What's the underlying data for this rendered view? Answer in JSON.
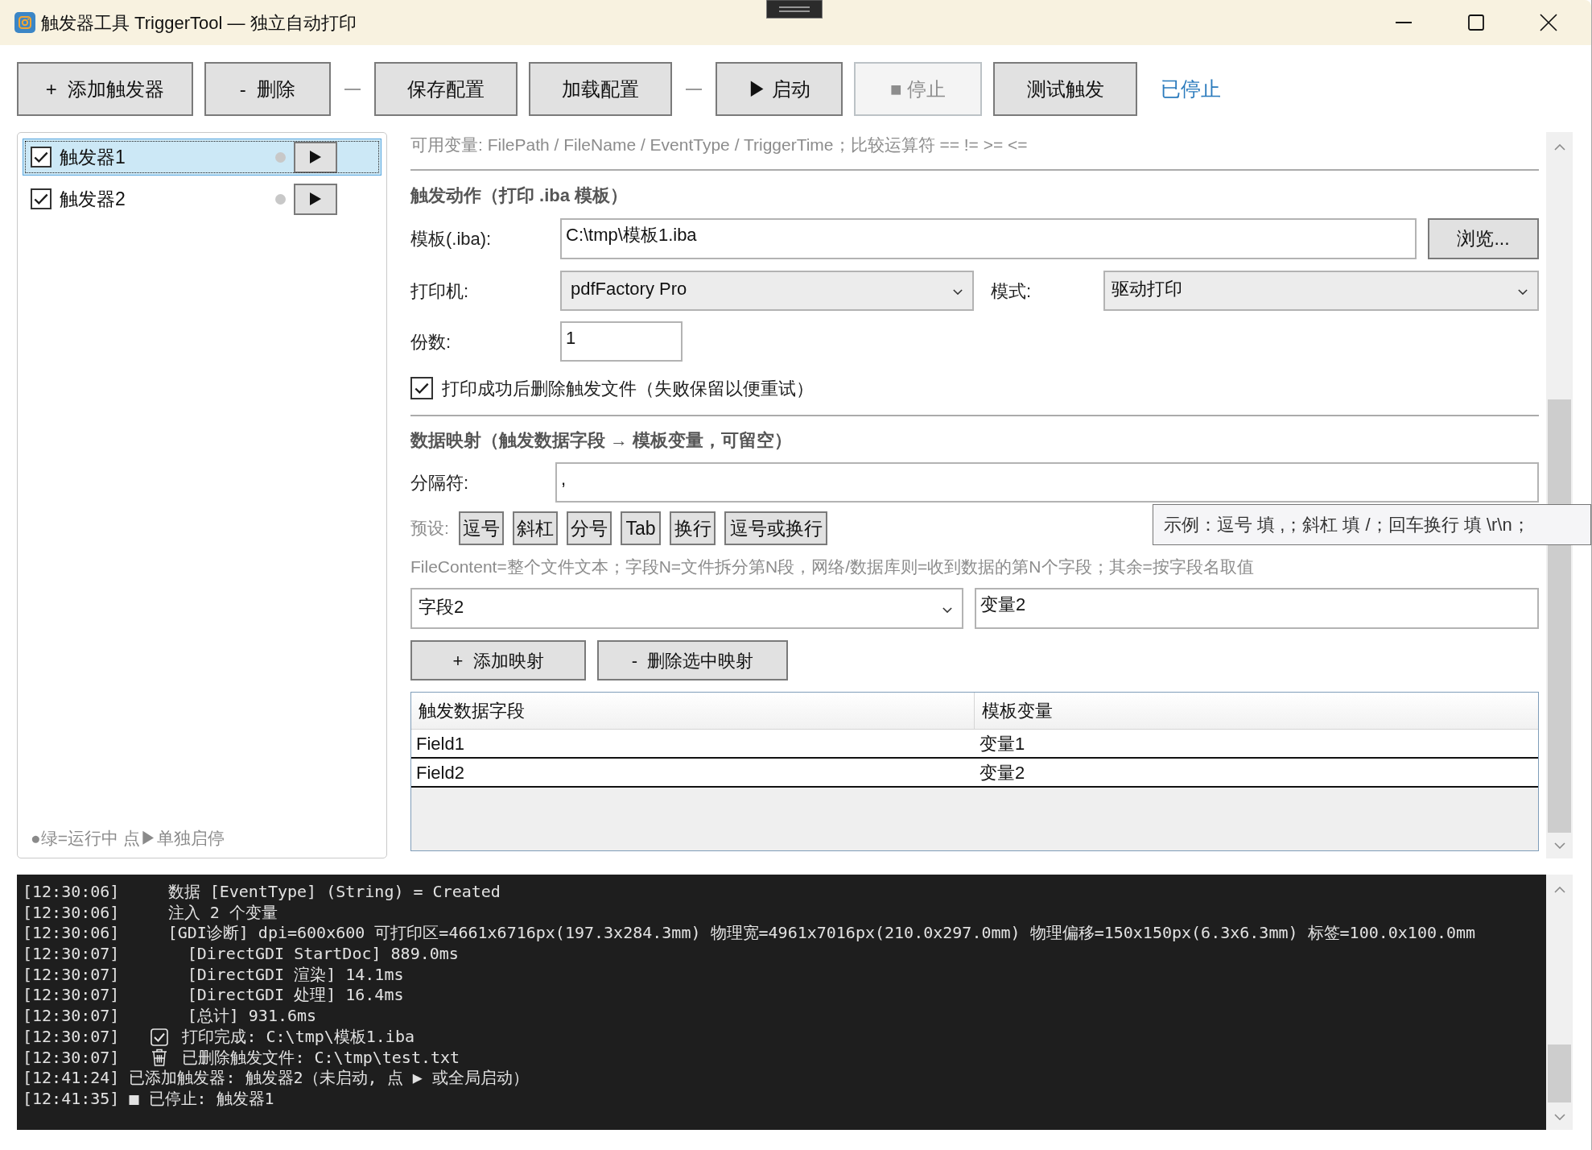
{
  "window": {
    "title": "触发器工具 TriggerTool — 独立自动打印"
  },
  "toolbar": {
    "items": [
      {
        "kind": "button",
        "label": "+  添加触发器",
        "disabled": false
      },
      {
        "kind": "button",
        "label": "-  删除",
        "disabled": false
      },
      {
        "kind": "separator"
      },
      {
        "kind": "button",
        "label": "保存配置",
        "disabled": false
      },
      {
        "kind": "button",
        "label": "加载配置",
        "disabled": false
      },
      {
        "kind": "separator"
      },
      {
        "kind": "button",
        "label": "▶ 启动",
        "disabled": false
      },
      {
        "kind": "button",
        "label": "■ 停止",
        "disabled": true
      },
      {
        "kind": "button",
        "label": "测试触发",
        "disabled": false
      }
    ],
    "status": "已停止"
  },
  "triggers": [
    {
      "name": "触发器1",
      "checked": true,
      "selected": true,
      "running": false
    },
    {
      "name": "触发器2",
      "checked": true,
      "selected": false,
      "running": false
    }
  ],
  "trigger_list_hint": "●绿=运行中 点▶单独启停",
  "variables_hint": "可用变量: FilePath / FileName / EventType / TriggerTime；比较运算符 == != >= <=",
  "print_action": {
    "heading": "触发动作（打印 .iba 模板）",
    "template": {
      "label": "模板(.iba):",
      "value": "C:\\tmp\\模板1.iba"
    },
    "browse_button": "浏览...",
    "printer": {
      "label": "打印机:",
      "value": "pdfFactory Pro"
    },
    "mode": {
      "label": "模式:",
      "value": "驱动打印"
    },
    "copies": {
      "label": "份数:",
      "value": "1"
    },
    "delete_after_print": {
      "label": "打印成功后删除触发文件（失败保留以便重试）",
      "checked": true
    }
  },
  "data_mapping": {
    "heading": "数据映射（触发数据字段 → 模板变量，可留空）",
    "separator": {
      "label": "分隔符:",
      "value": ","
    },
    "presets": {
      "label": "预设:",
      "buttons": [
        "逗号",
        "斜杠",
        "分号",
        "Tab",
        "换行",
        "逗号或换行"
      ]
    },
    "hint": "FileContent=整个文件文本；字段N=文件拆分第N段，网络/数据库则=收到数据的第N个字段；其余=按字段名取值",
    "field": {
      "value": "字段2"
    },
    "variable": {
      "value": "变量2"
    },
    "add_button": "+  添加映射",
    "remove_button": "-  删除选中映射",
    "table": {
      "columns": [
        "触发数据字段",
        "模板变量"
      ],
      "rows": [
        [
          "Field1",
          "变量1"
        ],
        [
          "Field2",
          "变量2"
        ]
      ]
    }
  },
  "tooltip": {
    "text": "示例：逗号 填 ,；斜杠 填 /；回车换行 填 \\r\\n；"
  },
  "log": {
    "lines": [
      {
        "kind": "plain",
        "text": "[12:30:06]     数据 [EventType] (String) = Created"
      },
      {
        "kind": "plain",
        "text": "[12:30:06]     注入 2 个变量"
      },
      {
        "kind": "plain",
        "text": "[12:30:06]     [GDI诊断] dpi=600x600 可打印区=4661x6716px(197.3x284.3mm) 物理宽=4961x7016px(210.0x297.0mm) 物理偏移=150x150px(6.3x6.3mm) 标签=100.0x100.0mm"
      },
      {
        "kind": "plain",
        "text": "[12:30:07]       [DirectGDI StartDoc] 889.0ms"
      },
      {
        "kind": "plain",
        "text": "[12:30:07]       [DirectGDI 渲染] 14.1ms"
      },
      {
        "kind": "plain",
        "text": "[12:30:07]       [DirectGDI 处理] 16.4ms"
      },
      {
        "kind": "plain",
        "text": "[12:30:07]       [总计] 931.6ms"
      },
      {
        "kind": "done",
        "time": "[12:30:07]",
        "text": "打印完成: C:\\tmp\\模板1.iba"
      },
      {
        "kind": "deleted",
        "time": "[12:30:07]",
        "text": "已删除触发文件: C:\\tmp\\test.txt"
      },
      {
        "kind": "plain",
        "text": "[12:41:24] 已添加触发器: 触发器2（未启动, 点 ▶ 或全局启动）"
      },
      {
        "kind": "plain",
        "text": "[12:41:35] ■ 已停止: 触发器1"
      }
    ]
  }
}
